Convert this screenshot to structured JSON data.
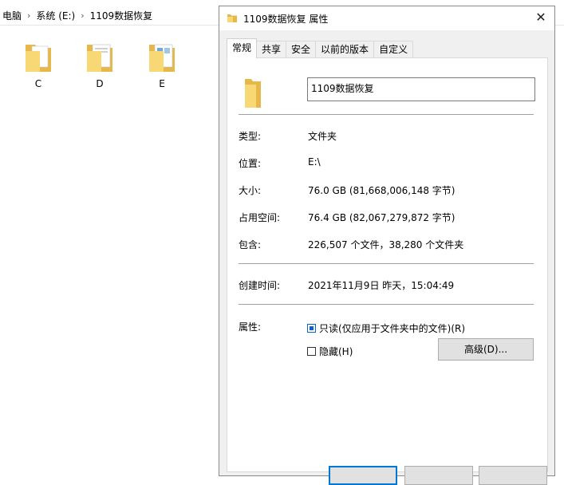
{
  "explorer": {
    "breadcrumb": [
      "电脑",
      "系统 (E:)",
      "1109数据恢复"
    ],
    "folders": [
      {
        "label": "C"
      },
      {
        "label": "D"
      },
      {
        "label": "E"
      }
    ]
  },
  "dialog": {
    "title": "1109数据恢复 属性",
    "close_glyph": "✕",
    "tabs": [
      "常规",
      "共享",
      "安全",
      "以前的版本",
      "自定义"
    ],
    "active_tab": "常规",
    "name_value": "1109数据恢复",
    "fields": {
      "type_label": "类型:",
      "type_value": "文件夹",
      "location_label": "位置:",
      "location_value": "E:\\",
      "size_label": "大小:",
      "size_value": "76.0 GB (81,668,006,148 字节)",
      "disk_size_label": "占用空间:",
      "disk_size_value": "76.4 GB (82,067,279,872 字节)",
      "contains_label": "包含:",
      "contains_value": "226,507 个文件，38,280 个文件夹",
      "created_label": "创建时间:",
      "created_value": "2021年11月9日 昨天，15:04:49",
      "attributes_label": "属性:"
    },
    "attributes": {
      "readonly_label": "只读(仅应用于文件夹中的文件)(R)",
      "readonly_checked": true,
      "hidden_label": "隐藏(H)",
      "hidden_checked": false,
      "advanced_button": "高级(D)..."
    },
    "colors": {
      "folder_yellow": "#f8d775",
      "folder_dark": "#e6b84a",
      "accent_blue": "#0078d7"
    }
  }
}
